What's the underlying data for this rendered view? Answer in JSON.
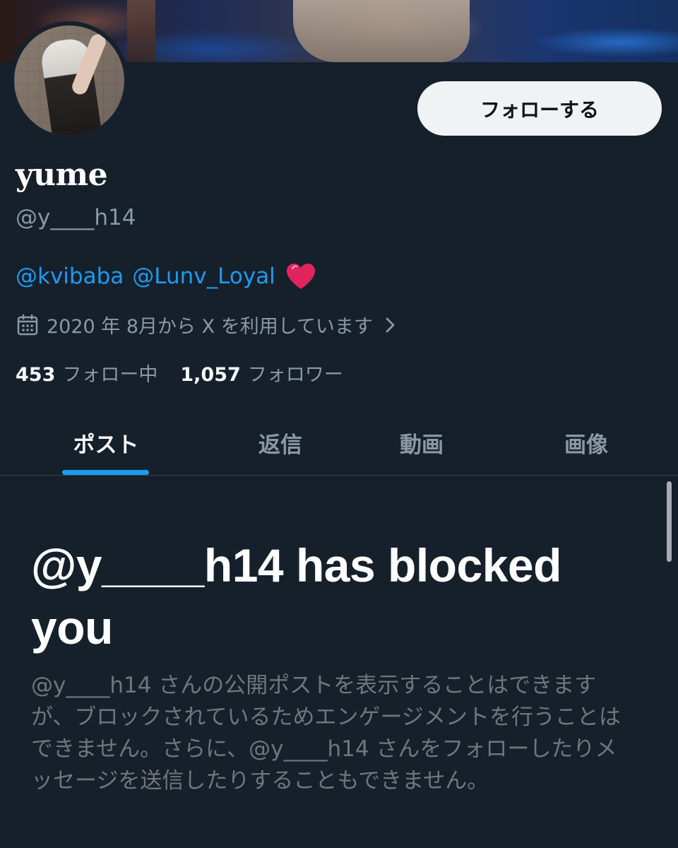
{
  "profile": {
    "display_name": "yume",
    "handle": "@y____h14",
    "bio_mention_1": "@kvibaba",
    "bio_mention_2": "@Lunv_Loyal",
    "joined": "2020 年 8月から X を利用しています",
    "following_count": "453",
    "following_label": "フォロー中",
    "followers_count": "1,057",
    "followers_label": "フォロワー"
  },
  "actions": {
    "follow_label": "フォローする"
  },
  "tabs": [
    {
      "label": "ポスト",
      "active": true
    },
    {
      "label": "返信",
      "active": false
    },
    {
      "label": "動画",
      "active": false
    },
    {
      "label": "画像",
      "active": false
    }
  ],
  "blocked": {
    "title": "@y____h14 has blocked you",
    "description": "@y____h14 さんの公開ポストを表示することはできますが、ブロックされているためエンゲージメントを行うことはできません。さらに、@y____h14 さんをフォローしたりメッセージを送信したりすることもできません。"
  },
  "icons": {
    "calendar": "calendar-icon",
    "chevron": "chevron-right-icon",
    "heart": "red-heart-emoji"
  },
  "colors": {
    "background": "#15202b",
    "accent": "#1d9bf0",
    "secondary_text": "#8b98a5",
    "heart": "#e0245e"
  }
}
